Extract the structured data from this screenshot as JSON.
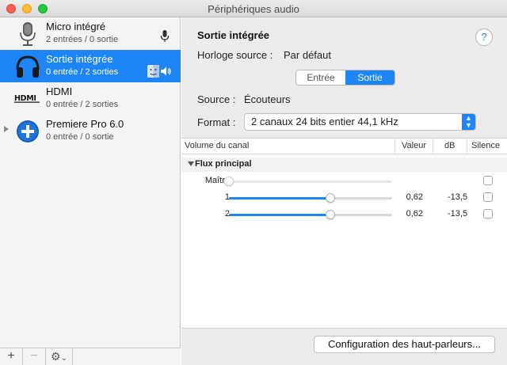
{
  "window": {
    "title": "Périphériques audio"
  },
  "sidebar": {
    "devices": [
      {
        "name": "Micro intégré",
        "sub": "2 entrées / 0 sortie",
        "icon": "microphone-icon",
        "selected": false
      },
      {
        "name": "Sortie intégrée",
        "sub": "0 entrée / 2 sorties",
        "icon": "headphones-icon",
        "selected": true
      },
      {
        "name": "HDMI",
        "sub": "0 entrée / 2 sorties",
        "icon": "hdmi-icon",
        "selected": false
      },
      {
        "name": "Premiere Pro 6.0",
        "sub": "0 entrée / 0 sortie",
        "icon": "plus-circle-icon",
        "selected": false
      }
    ],
    "footer": {
      "add": "+",
      "remove": "−",
      "settings": "⚙",
      "chevron": "⌄"
    }
  },
  "detail": {
    "title": "Sortie intégrée",
    "clock_label": "Horloge source :",
    "clock_value": "Par défaut",
    "help": "?",
    "tabs": [
      "Entrée",
      "Sortie"
    ],
    "active_tab": "Sortie",
    "source_label": "Source :",
    "source_value": "Écouteurs",
    "format_label": "Format :",
    "format_value": "2 canaux 24 bits entier 44,1 kHz",
    "format_arrow": "▲▼",
    "table": {
      "headers": {
        "channel": "Volume du canal",
        "value": "Valeur",
        "db": "dB",
        "mute": "Silence"
      },
      "group": "Flux principal",
      "master": {
        "name": "Maître",
        "level": 0.0
      },
      "channels": [
        {
          "name": "1",
          "value": "0,62",
          "db": "-13,5",
          "level": 0.62,
          "muted": false
        },
        {
          "name": "2",
          "value": "0,62",
          "db": "-13,5",
          "level": 0.62,
          "muted": false
        }
      ]
    },
    "speaker_config": "Configuration des haut-parleurs..."
  },
  "colors": {
    "accent": "#1d85f5",
    "selected_row": "#1d85f5"
  }
}
